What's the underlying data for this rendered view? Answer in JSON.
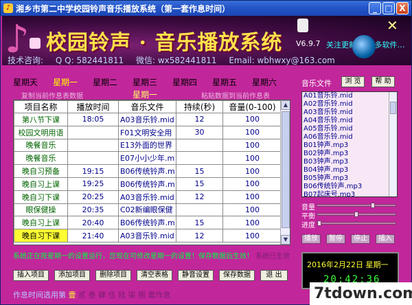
{
  "window": {
    "title": "湘乡市第二中学校园铃声音乐播放系统（第一套作息时间）",
    "min": "_",
    "max": "□",
    "close": "X"
  },
  "banner": {
    "app_title": "校园铃声 · 音乐播放系统",
    "version": "V6.9.7",
    "marquee": "关注更新  ▶ 更多软件…",
    "contact_label": "技术咨询:",
    "qq": "Q Q: 582441811",
    "wechat": "微信: wx582441811",
    "email": "Email: wbhwxy@163.com"
  },
  "days": [
    "星期天",
    "星期一",
    "星期二",
    "星期三",
    "星期四",
    "星期五",
    "星期六"
  ],
  "active_day_index": 1,
  "subline": {
    "copy": "复制当前作息表数据",
    "dayname": "星期一",
    "paste": "粘贴数据到当前作息表"
  },
  "table": {
    "headers": [
      "项目名称",
      "播放时间",
      "音乐文件",
      "持续(秒)",
      "音量(0-100)"
    ],
    "rows": [
      {
        "name": "第八节下课",
        "time": "18:05",
        "file": "A03音乐铃.mid",
        "dur": "12",
        "vol": "100"
      },
      {
        "name": "校园文明用语",
        "time": "",
        "file": "F01文明安全用",
        "dur": "30",
        "vol": "100"
      },
      {
        "name": "晚餐音乐",
        "time": "",
        "file": "E13外面的世界",
        "dur": "",
        "vol": "100"
      },
      {
        "name": "晚餐音乐",
        "time": "",
        "file": "E07小小少年.m",
        "dur": "",
        "vol": "100"
      },
      {
        "name": "晚自习预备",
        "time": "19:15",
        "file": "B06传统铃声.m",
        "dur": "15",
        "vol": "100"
      },
      {
        "name": "晚自习上课",
        "time": "19:25",
        "file": "B06传统铃声.m",
        "dur": "15",
        "vol": "100"
      },
      {
        "name": "晚自习下课",
        "time": "20:25",
        "file": "A03音乐铃.mid",
        "dur": "12",
        "vol": "100"
      },
      {
        "name": "眼保健操",
        "time": "20:35",
        "file": "C02新编眼保健",
        "dur": "",
        "vol": "100"
      },
      {
        "name": "晚自习上课",
        "time": "20:40",
        "file": "B06传统铃声.m",
        "dur": "15",
        "vol": "100"
      },
      {
        "name": "晚自习下课",
        "time": "21:40",
        "file": "A03音乐铃.mid",
        "dur": "12",
        "vol": "100"
      }
    ]
  },
  "status": {
    "main": "系统正在按星期一的设置运行，您现在可修改星期一的设置！保存数据后生效！",
    "extra": "系统已生效"
  },
  "buttons": [
    "插入项目",
    "添加项目",
    "删除项目",
    "清空表格",
    "静音设置",
    "保存数据",
    "退 出"
  ],
  "schemes": {
    "label": "作息时间选用第",
    "items": [
      "壹",
      "贰",
      "叁",
      "肆",
      "伍",
      "陆",
      "柒",
      "捌"
    ],
    "suffix": "套作息",
    "active_index": 0
  },
  "music": {
    "label": "音乐文件",
    "browse": "浏 览",
    "help": "帮 助",
    "files": [
      "A01音乐铃.mid",
      "A02音乐铃.mid",
      "A03音乐铃.mid",
      "A04音乐铃.mid",
      "A05音乐铃.mid",
      "A06音乐铃.mid",
      "B01钟声.mp3",
      "B02钟声.mp3",
      "B03钟声.mp3",
      "B04钟声.mp3",
      "B05钟声.mp3",
      "B06传统铃声.mp3",
      "B07起床号.mp3"
    ]
  },
  "sliders": {
    "volume_label": "音量",
    "balance_label": "平衡",
    "progress_label": "进度",
    "volume_level": 0.72,
    "balance_level": 0.5,
    "progress_level": 0.0
  },
  "controls": [
    "播放",
    "暂停",
    "停止",
    "插入"
  ],
  "clock": {
    "date": "2016年2月22日  星期一",
    "time": "20:42:36"
  },
  "watermark": "7tdown.com"
}
